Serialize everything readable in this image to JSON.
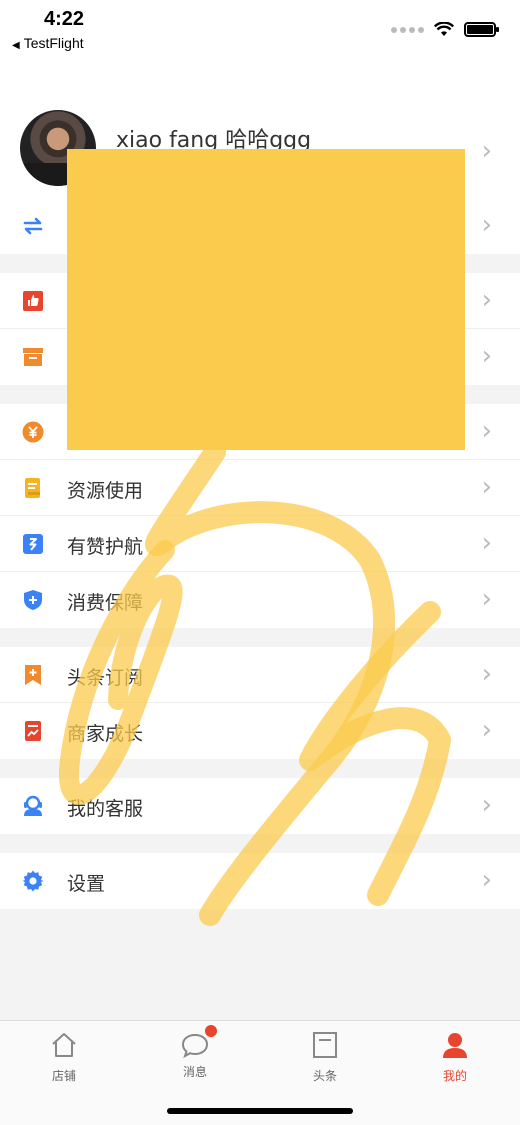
{
  "status_bar": {
    "time": "4:22",
    "back_app": "TestFlight"
  },
  "profile": {
    "name": "xiao fang 哈哈ggg"
  },
  "menu_groups": [
    [
      {
        "icon": "swap-icon",
        "label": ""
      }
    ],
    [
      {
        "icon": "thumbs-up-icon",
        "label": ""
      },
      {
        "icon": "archive-icon",
        "label": ""
      }
    ],
    [
      {
        "icon": "yen-coin-icon",
        "label": ""
      },
      {
        "icon": "document-icon",
        "label": "资源使用"
      },
      {
        "icon": "zan-icon",
        "label": "有赞护航"
      },
      {
        "icon": "shield-plus-icon",
        "label": "消费保障"
      }
    ],
    [
      {
        "icon": "bookmark-plus-icon",
        "label": "头条订阅"
      },
      {
        "icon": "growth-report-icon",
        "label": "商家成长"
      }
    ],
    [
      {
        "icon": "customer-service-icon",
        "label": "我的客服"
      }
    ],
    [
      {
        "icon": "gear-icon",
        "label": "设置"
      }
    ]
  ],
  "tabbar": {
    "items": [
      {
        "label": "店铺",
        "icon": "store-icon"
      },
      {
        "label": "消息",
        "icon": "chat-bubble-icon"
      },
      {
        "label": "头条",
        "icon": "headline-icon"
      },
      {
        "label": "我的",
        "icon": "person-icon"
      }
    ],
    "active": "我的"
  },
  "colors": {
    "accent": "#e8442e",
    "blue": "#3b82f6",
    "orange": "#f08a2c",
    "yellow_redaction": "#fbcb4d"
  }
}
